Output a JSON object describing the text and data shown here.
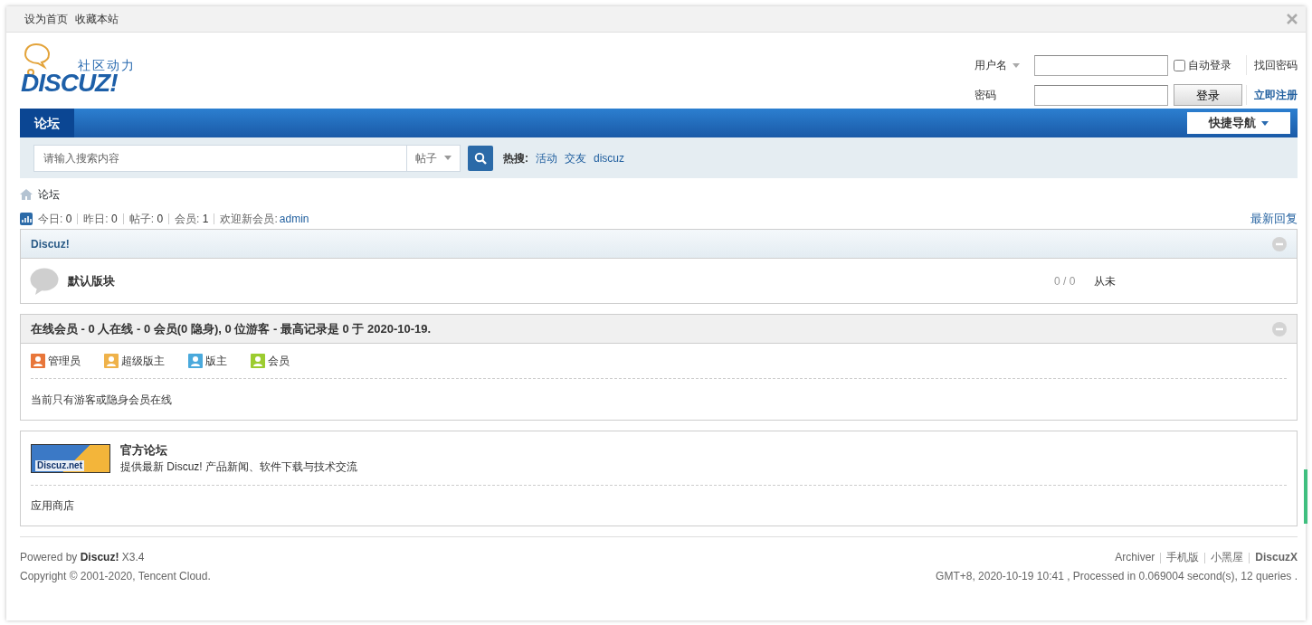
{
  "topbar": {
    "links": [
      "设为首页",
      "收藏本站"
    ]
  },
  "logo": {
    "tagline": "社区动力",
    "wordmark": "DISCUZ!"
  },
  "login": {
    "username_label": "用户名",
    "password_label": "密码",
    "remember": {
      "label": "自动登录",
      "checked": false
    },
    "login_button": "登录",
    "links": [
      {
        "label": "找回密码",
        "bold": false
      },
      {
        "label": "立即注册",
        "bold": true
      }
    ]
  },
  "nav": {
    "items": [
      {
        "label": "论坛",
        "selected": true
      }
    ],
    "quick_nav": "快捷导航"
  },
  "search": {
    "placeholder": "请输入搜索内容",
    "type": "帖子",
    "hot_label": "热搜:",
    "hot_terms": [
      "活动",
      "交友",
      "discuz"
    ]
  },
  "breadcrumb": [
    "论坛"
  ],
  "stats": {
    "items": [
      {
        "label": "今日:",
        "value": "0"
      },
      {
        "label": "昨日:",
        "value": "0"
      },
      {
        "label": "帖子:",
        "value": "0"
      },
      {
        "label": "会员:",
        "value": "1"
      }
    ],
    "welcome": "欢迎新会员:",
    "new_member": "admin",
    "latest_link": "最新回复"
  },
  "categories": [
    {
      "title": "Discuz!",
      "expanded": true,
      "forums": [
        {
          "name": "默认版块",
          "counts": "0 / 0",
          "last_post": "从未"
        }
      ]
    }
  ],
  "online": {
    "title": "在线会员 - 0 人在线 - 0 会员(0 隐身), 0 位游客 - 最高记录是 0 于 2020-10-19.",
    "expanded": true,
    "legend": [
      {
        "label": "管理员",
        "color": "#e8763a"
      },
      {
        "label": "超级版主",
        "color": "#efb24a"
      },
      {
        "label": "版主",
        "color": "#4aa9dc"
      },
      {
        "label": "会员",
        "color": "#9ccc30"
      }
    ],
    "message": "当前只有游客或隐身会员在线"
  },
  "friend_links": {
    "logo_text": "Discuz.net",
    "title": "官方论坛",
    "description": "提供最新 Discuz! 产品新闻、软件下载与技术交流",
    "text_links": [
      "应用商店"
    ]
  },
  "footer": {
    "powered": "Powered by **Discuz!** X3.4",
    "copyright": "Copyright © 2001-2020, Tencent Cloud.",
    "links": [
      {
        "label": "Archiver",
        "bold": false
      },
      {
        "label": "手机版",
        "bold": false
      },
      {
        "label": "小黑屋",
        "bold": false
      },
      {
        "label": "DiscuzX",
        "bold": true
      }
    ],
    "status": "GMT+8, 2020-10-19 10:41 , Processed in 0.069004 second(s), 12 queries ."
  }
}
